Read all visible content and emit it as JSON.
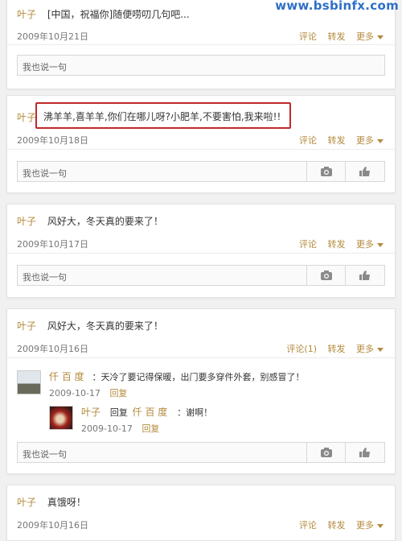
{
  "watermark": "www.bsbinfx.com",
  "posts": [
    {
      "author": "叶子",
      "content": "[中国，祝福你]随便唠叨几句吧...",
      "date": "2009年10月21日",
      "input_placeholder": "我也说一句",
      "actions": {
        "comment": "评论",
        "forward": "转发",
        "more": "更多"
      }
    },
    {
      "author": "叶子",
      "content": "沸羊羊,喜羊羊,你们在哪儿呀?小肥羊,不要害怕,我来啦!!",
      "date": "2009年10月18日",
      "input_placeholder": "我也说一句",
      "actions": {
        "comment": "评论",
        "forward": "转发",
        "more": "更多"
      }
    },
    {
      "author": "叶子",
      "content": "风好大，冬天真的要来了！",
      "date": "2009年10月17日",
      "input_placeholder": "我也说一句",
      "actions": {
        "comment": "评论",
        "forward": "转发",
        "more": "更多"
      }
    },
    {
      "author": "叶子",
      "content": "风好大，冬天真的要来了！",
      "date": "2009年10月16日",
      "input_placeholder": "我也说一句",
      "actions": {
        "comment": "评论(1)",
        "forward": "转发",
        "more": "更多"
      },
      "comments": [
        {
          "author": "仟 百 度",
          "text": "：天冷了要记得保暖，出门要多穿件外套，别感冒了！",
          "date": "2009-10-17",
          "reply": "回复"
        },
        {
          "author": "叶子",
          "reply_prefix": "回复",
          "reply_to": "仟 百 度",
          "text": "：谢啊！",
          "date": "2009-10-17",
          "reply": "回复"
        }
      ]
    },
    {
      "author": "叶子",
      "content": "真饿呀！",
      "date": "2009年10月16日",
      "actions": {
        "comment": "评论",
        "forward": "转发",
        "more": "更多"
      }
    }
  ],
  "icons": {
    "camera": "camera-icon",
    "like": "thumbs-up-icon",
    "caret": "caret-down-icon"
  }
}
